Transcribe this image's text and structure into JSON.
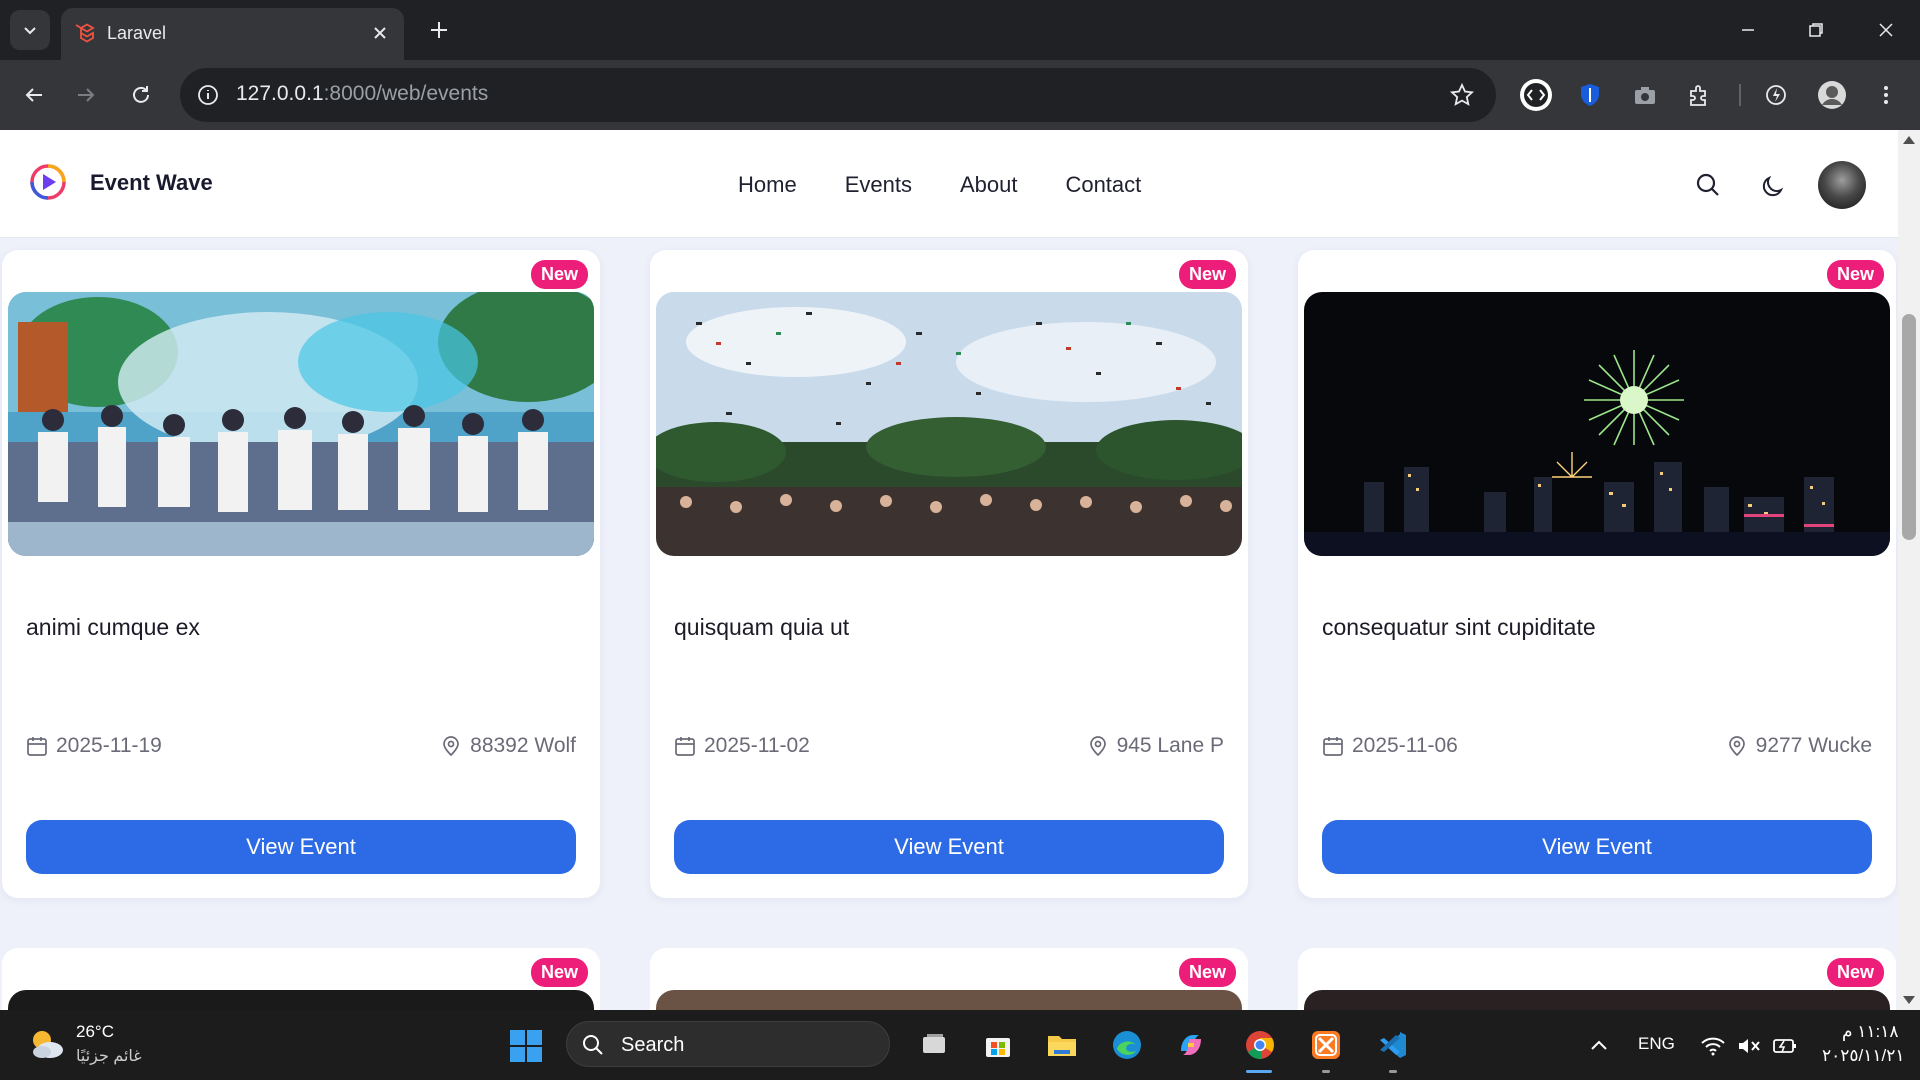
{
  "browser": {
    "tab_title": "Laravel",
    "url_host": "127.0.0.1",
    "url_rest": ":8000/web/events"
  },
  "site": {
    "brand": "Event Wave",
    "nav": [
      "Home",
      "Events",
      "About",
      "Contact"
    ]
  },
  "events": [
    {
      "badge": "New",
      "title": "animi cumque ex",
      "date": "2025-11-19",
      "location": "88392 Wolf",
      "button": "View Event"
    },
    {
      "badge": "New",
      "title": "quisquam quia ut",
      "date": "2025-11-02",
      "location": "945 Lane P",
      "button": "View Event"
    },
    {
      "badge": "New",
      "title": "consequatur sint cupiditate",
      "date": "2025-11-06",
      "location": "9277 Wucke",
      "button": "View Event"
    }
  ],
  "more_events": [
    {
      "badge": "New"
    },
    {
      "badge": "New"
    },
    {
      "badge": "New"
    }
  ],
  "taskbar": {
    "weather_temp": "26°C",
    "weather_desc": "غائم جزئيًا",
    "search_label": "Search",
    "lang": "ENG",
    "time": "١١:١٨ م",
    "date": "٢٠٢٥/١١/٢١"
  },
  "colors": {
    "accent": "#2c6ae6",
    "badge": "#ed1e79",
    "page_bg": "#eef1fa"
  }
}
